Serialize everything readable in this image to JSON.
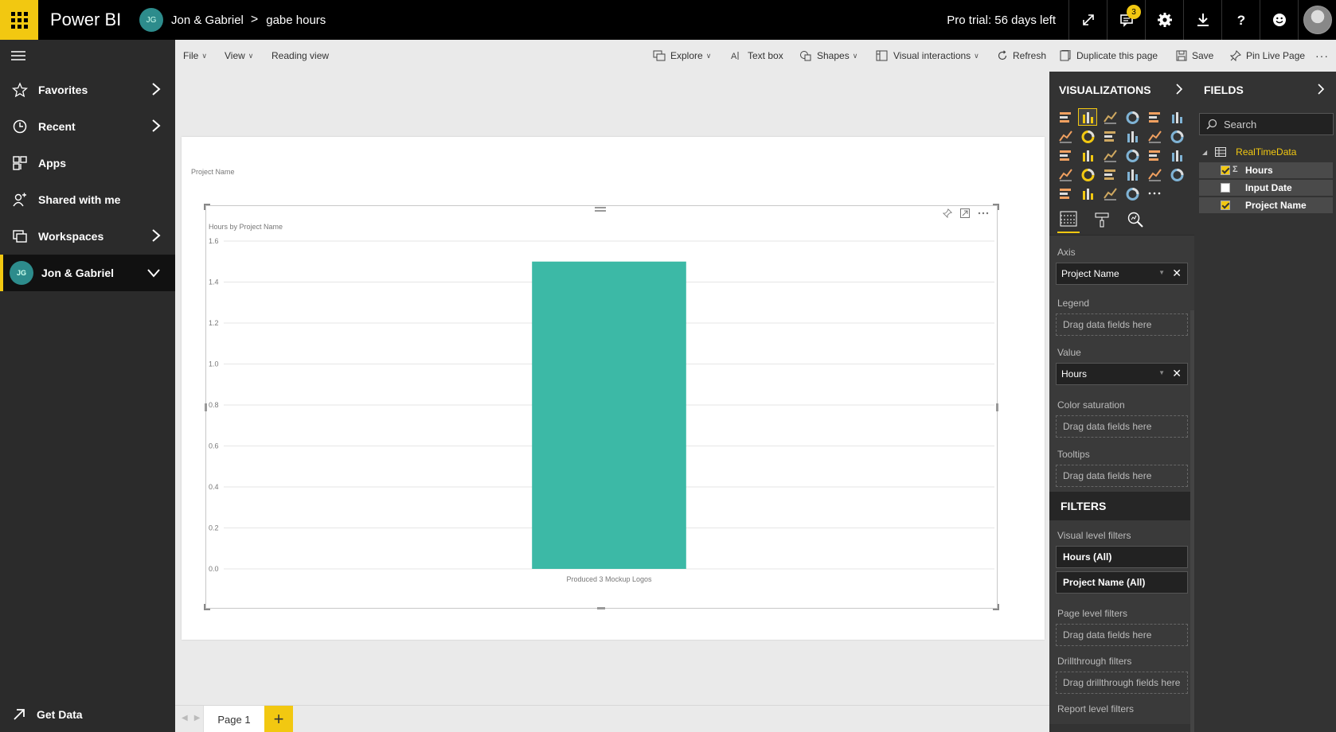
{
  "app": {
    "brand": "Power BI",
    "workspace_initials": "JG",
    "breadcrumb_workspace": "Jon & Gabriel",
    "breadcrumb_sep": ">",
    "breadcrumb_report": "gabe hours",
    "trial_text": "Pro trial: 56 days left",
    "notification_count": "3"
  },
  "nav": {
    "items": [
      {
        "label": "Favorites",
        "icon": "star-icon"
      },
      {
        "label": "Recent",
        "icon": "clock-icon"
      },
      {
        "label": "Apps",
        "icon": "apps-icon"
      },
      {
        "label": "Shared with me",
        "icon": "shared-icon"
      },
      {
        "label": "Workspaces",
        "icon": "workspaces-icon"
      },
      {
        "label": "Jon & Gabriel",
        "icon": "workspace-avatar",
        "initials": "JG"
      }
    ],
    "get_data": "Get Data"
  },
  "commands": {
    "file": "File",
    "view": "View",
    "reading_view": "Reading view",
    "explore": "Explore",
    "text_box": "Text box",
    "shapes": "Shapes",
    "visual_interactions": "Visual interactions",
    "refresh": "Refresh",
    "duplicate": "Duplicate this page",
    "save": "Save",
    "pin_live": "Pin Live Page",
    "more": "···"
  },
  "canvas": {
    "slicer_label": "Project Name",
    "chart_title": "Hours by Project Name"
  },
  "chart_data": {
    "type": "bar",
    "title": "Hours by Project Name",
    "categories": [
      "Produced 3 Mockup Logos"
    ],
    "values": [
      1.5
    ],
    "ylim": [
      0,
      1.6
    ],
    "yticks": [
      "0.0",
      "0.2",
      "0.4",
      "0.6",
      "0.8",
      "1.0",
      "1.2",
      "1.4",
      "1.6"
    ],
    "xlabel": "",
    "ylabel": "",
    "grid": true,
    "bar_color": "#3cb9a6"
  },
  "pages": {
    "tab": "Page 1",
    "add": "+"
  },
  "viz": {
    "title": "VISUALIZATIONS",
    "wells": {
      "axis_label": "Axis",
      "axis_value": "Project Name",
      "legend_label": "Legend",
      "legend_drop": "Drag data fields here",
      "value_label": "Value",
      "value_value": "Hours",
      "color_label": "Color saturation",
      "color_drop": "Drag data fields here",
      "tooltips_label": "Tooltips",
      "tooltips_drop": "Drag data fields here"
    },
    "filters": {
      "title": "FILTERS",
      "visual_level": "Visual level filters",
      "hours_all": "Hours  (All)",
      "project_all": "Project Name  (All)",
      "page_level": "Page level filters",
      "page_drop": "Drag data fields here",
      "drillthrough": "Drillthrough filters",
      "drill_drop": "Drag drillthrough fields here",
      "report_level": "Report level filters"
    }
  },
  "fields": {
    "title": "FIELDS",
    "search_placeholder": "Search",
    "table_name": "RealTimeData",
    "items": [
      {
        "name": "Hours",
        "checked": true,
        "sigma": "Σ"
      },
      {
        "name": "Input Date",
        "checked": false
      },
      {
        "name": "Project Name",
        "checked": true
      }
    ]
  },
  "colors": {
    "accent": "#f2c811",
    "bar": "#3cb9a6",
    "nav_bg": "#2b2b2b",
    "pane_bg": "#333333"
  }
}
